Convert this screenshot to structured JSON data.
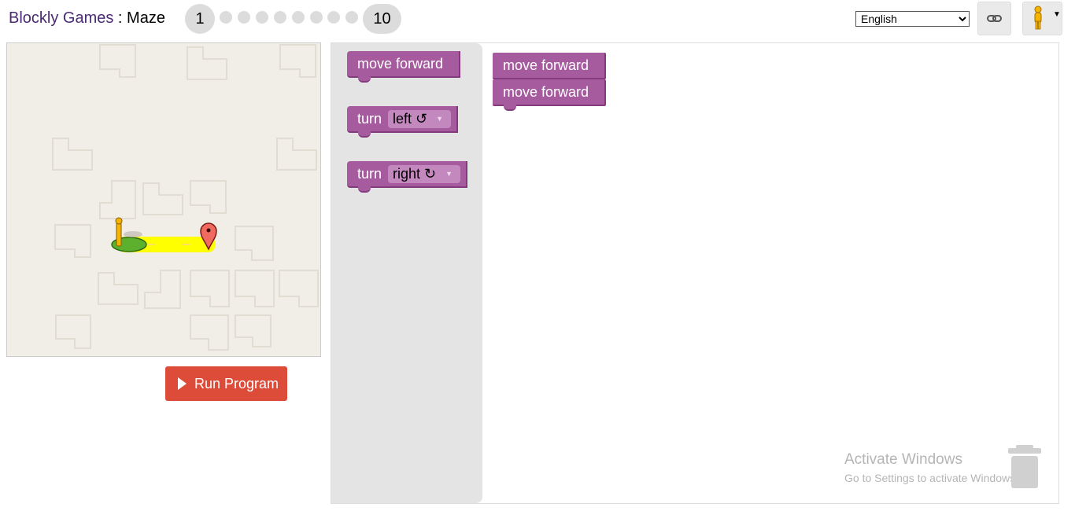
{
  "header": {
    "app_name": "Blockly Games",
    "separator": " : ",
    "game_name": "Maze",
    "levels": {
      "first": "1",
      "last": "10",
      "current": 1,
      "total": 10
    },
    "language": {
      "selected": "English",
      "options": [
        "English"
      ]
    },
    "link_icon": "link-icon",
    "pegman_icon": "pegman-icon"
  },
  "maze": {
    "start_icon": "pegman-start-icon",
    "goal_icon": "map-marker-goal-icon",
    "run_button_label": "Run Program"
  },
  "toolbox": {
    "blocks": [
      {
        "label": "move forward"
      },
      {
        "label": "turn",
        "dropdown": "left ↺"
      },
      {
        "label": "turn",
        "dropdown": "right ↻"
      }
    ]
  },
  "workspace": {
    "blocks": [
      {
        "label": "move forward"
      },
      {
        "label": "move forward"
      }
    ],
    "trash_icon": "trash-icon"
  },
  "watermark": {
    "line1": "Activate Windows",
    "line2": "Go to Settings to activate Windows."
  },
  "colors": {
    "block": "#a55b9e",
    "run_button": "#dd4b39",
    "path": "#ffff00",
    "maze_bg": "#f1eee7"
  }
}
